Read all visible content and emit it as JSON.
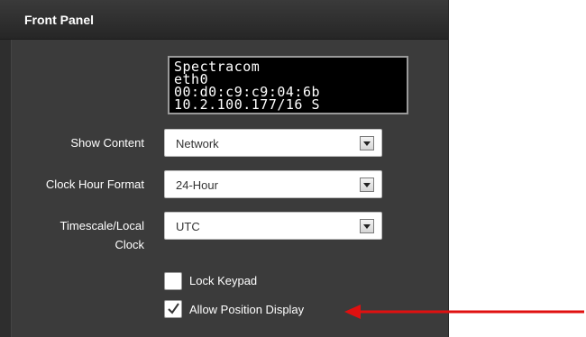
{
  "window": {
    "title": "Front Panel"
  },
  "lcd": {
    "lines": [
      "Spectracom",
      "eth0",
      "00:d0:c9:c9:04:6b",
      "10.2.100.177/16 S"
    ]
  },
  "fields": {
    "show_content": {
      "label": "Show Content",
      "value": "Network"
    },
    "clock_hour_format": {
      "label": "Clock Hour Format",
      "value": "24-Hour"
    },
    "timescale": {
      "label_line1": "Timescale/Local",
      "label_line2": "Clock",
      "value": "UTC"
    }
  },
  "checkboxes": {
    "lock_keypad": {
      "label": "Lock Keypad",
      "checked": false
    },
    "allow_position_display": {
      "label": "Allow Position Display",
      "checked": true
    }
  },
  "annotation": {
    "arrow_color": "#e01010",
    "icon": "arrow-left-icon"
  },
  "colors": {
    "panel_bg": "#3b3b3b",
    "titlebar_bg": "#262626",
    "text": "#ffffff"
  }
}
